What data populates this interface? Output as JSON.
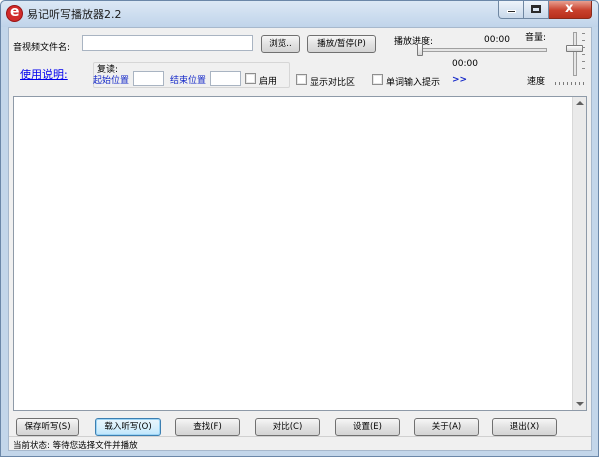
{
  "window": {
    "title": "易记听写播放器2.2",
    "close_symbol": "x"
  },
  "top": {
    "file_label": "音视频文件名:",
    "file_value": "",
    "browse_label": "浏览..",
    "play_pause_label": "播放/暂停(P)",
    "progress_label": "播放进度:",
    "time_total": "00:00",
    "time_current": "00:00",
    "volume_label": "音量:",
    "speed_label": "速度",
    "usage_link": "使用说明:",
    "repeat_label": "复读:",
    "start_label": "起始位置",
    "start_value": "",
    "end_label": "结束位置",
    "end_value": "",
    "enable_label": "启用",
    "show_compare_label": "显示对比区",
    "word_hint_label": "单词输入提示",
    "more_label": ">>"
  },
  "editor": {
    "content": ""
  },
  "buttons": {
    "save": "保存听写(S)",
    "load": "载入听写(O)",
    "find": "查找(F)",
    "compare": "对比(C)",
    "settings": "设置(E)",
    "about": "关于(A)",
    "exit": "退出(X)"
  },
  "status": {
    "text": "当前状态: 等待您选择文件并播放"
  }
}
